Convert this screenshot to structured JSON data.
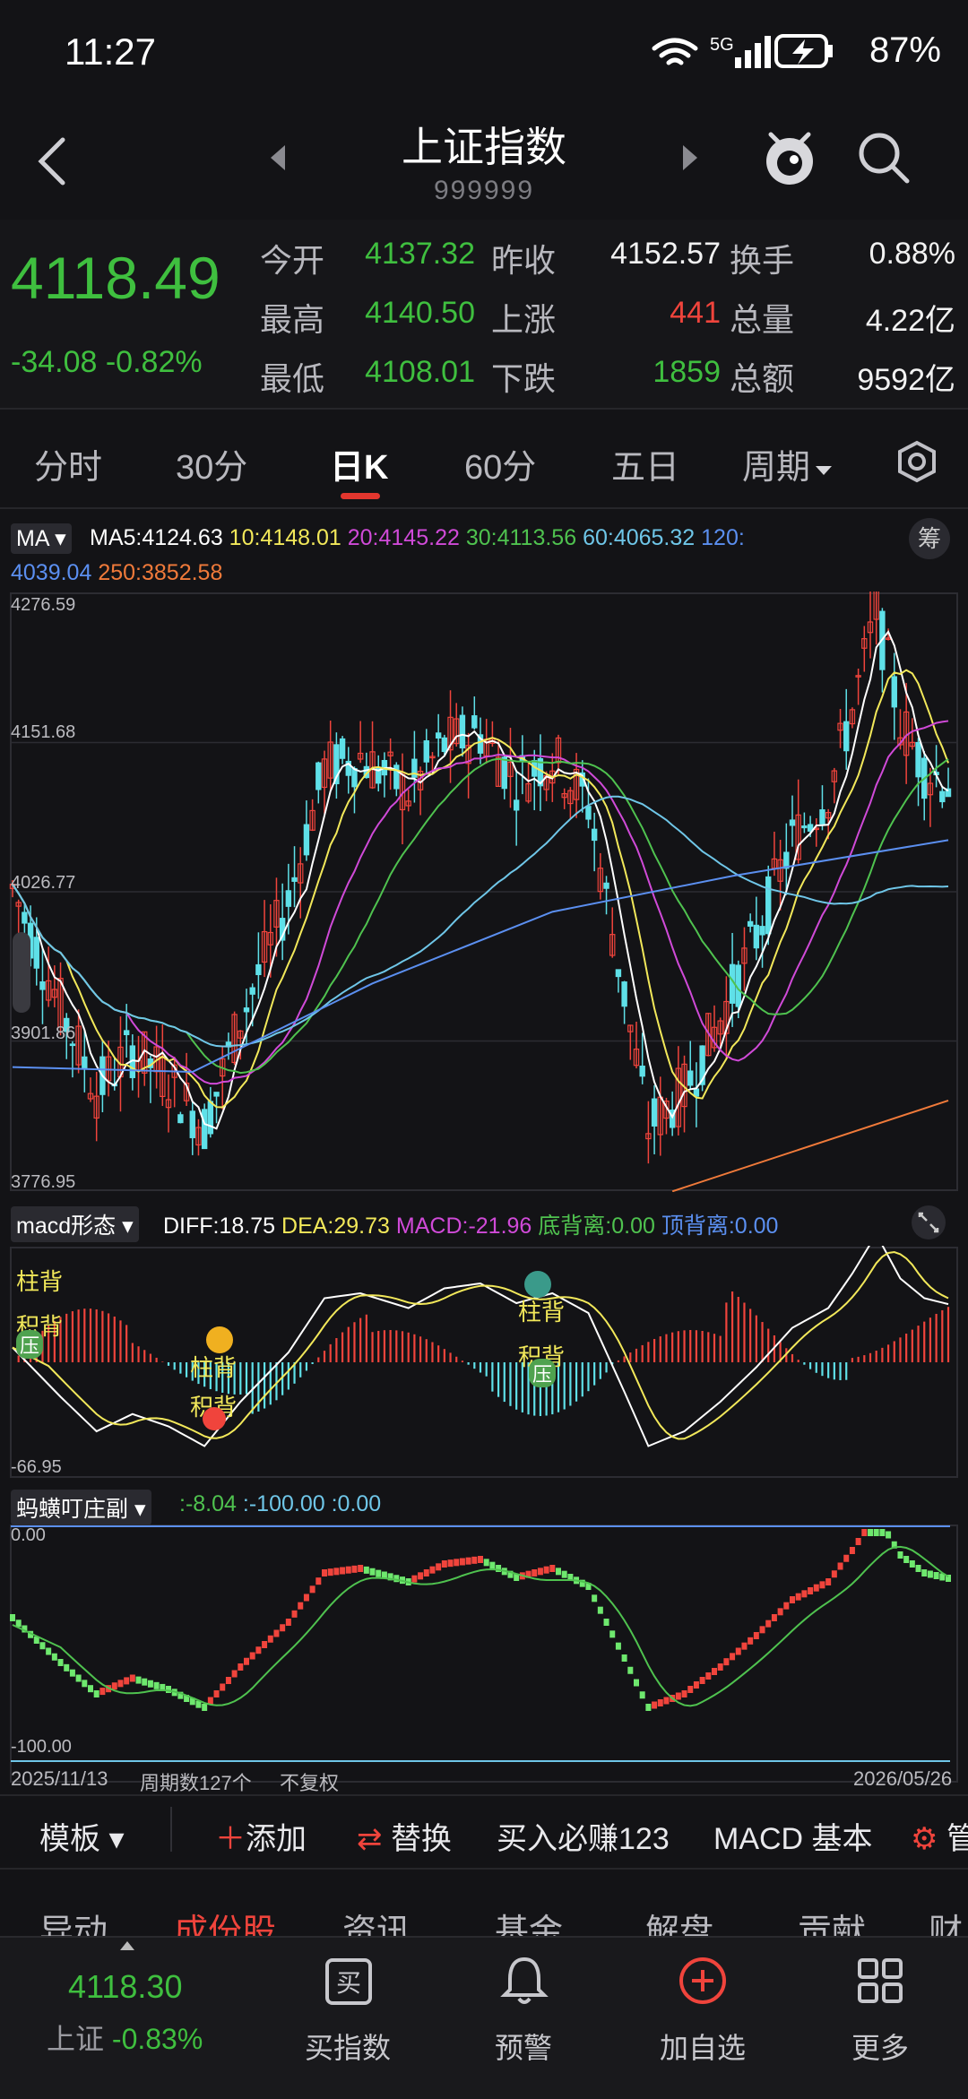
{
  "status": {
    "time": "11:27",
    "network": "5G",
    "battery": "87%"
  },
  "header": {
    "title": "上证指数",
    "code": "999999"
  },
  "quote": {
    "price": "4118.49",
    "change": "-34.08",
    "change_pct": "-0.82%",
    "rows": [
      [
        {
          "label": "今开",
          "value": "4137.32",
          "color": "green"
        },
        {
          "label": "昨收",
          "value": "4152.57",
          "color": "white"
        },
        {
          "label": "换手",
          "value": "0.88%",
          "color": "white"
        }
      ],
      [
        {
          "label": "最高",
          "value": "4140.50",
          "color": "green"
        },
        {
          "label": "上涨",
          "value": "441",
          "color": "red"
        },
        {
          "label": "总量",
          "value": "4.22亿",
          "color": "white"
        }
      ],
      [
        {
          "label": "最低",
          "value": "4108.01",
          "color": "green"
        },
        {
          "label": "下跌",
          "value": "1859",
          "color": "green"
        },
        {
          "label": "总额",
          "value": "9592亿",
          "color": "white"
        }
      ]
    ]
  },
  "period_tabs": [
    "分时",
    "30分",
    "日K",
    "60分",
    "五日",
    "周期"
  ],
  "main_chart": {
    "selector": "MA",
    "badge": "筹",
    "ma_legend": [
      {
        "text": "MA5:4124.63",
        "color": "#ffffff"
      },
      {
        "text": "10:4148.01",
        "color": "#f2e85a"
      },
      {
        "text": "20:4145.22",
        "color": "#d04ad8"
      },
      {
        "text": "30:4113.56",
        "color": "#4fc24f"
      },
      {
        "text": "60:4065.32",
        "color": "#6fc6e8"
      },
      {
        "text": "120:",
        "color": "#5b8ff0"
      },
      {
        "text": "4039.04",
        "color": "#5b8ff0"
      },
      {
        "text": "250:3852.58",
        "color": "#f07a3a"
      }
    ],
    "y_ticks": [
      "4276.59",
      "4151.68",
      "4026.77",
      "3901.86",
      "3776.95"
    ]
  },
  "macd": {
    "selector": "macd形态",
    "legend": [
      {
        "text": "DIFF:18.75",
        "color": "#ffffff"
      },
      {
        "text": "DEA:29.73",
        "color": "#f2e85a"
      },
      {
        "text": "MACD:-21.96",
        "color": "#d04ad8"
      },
      {
        "text": "底背离:0.00",
        "color": "#4fc24f"
      },
      {
        "text": "顶背离:0.00",
        "color": "#5b8ff0"
      }
    ],
    "y_min": "-66.95",
    "annotations": [
      "柱背",
      "积背",
      "压",
      "柱背",
      "积背",
      "柱背",
      "积背",
      "压"
    ]
  },
  "osc": {
    "selector": "蚂蟥叮庄副",
    "legend": [
      {
        "text": ":-8.04",
        "color": "#4fc24f"
      },
      {
        "text": ":-100.00",
        "color": "#6fc6e8"
      },
      {
        "text": ":0.00",
        "color": "#6fc6e8"
      }
    ],
    "y_top": "0.00",
    "y_bottom": "-100.00"
  },
  "footer_info": {
    "start_date": "2025/11/13",
    "count": "周期数127个",
    "adjust": "不复权",
    "end_date": "2026/05/26"
  },
  "toolbar": [
    "模板",
    "添加",
    "替换",
    "买入必赚123",
    "MACD 基本",
    "管"
  ],
  "bottom_tabs": [
    "异动",
    "成份股",
    "资讯",
    "基金",
    "解盘",
    "贡献",
    "财"
  ],
  "nav": {
    "index_value": "4118.30",
    "index_label": "上证",
    "index_change": "-0.83%",
    "items": [
      "买指数",
      "预警",
      "加自选",
      "更多"
    ]
  },
  "colors": {
    "up": "#f0443c",
    "down": "#3fbf3f",
    "bg": "#131316",
    "accent": "#e3362e"
  }
}
